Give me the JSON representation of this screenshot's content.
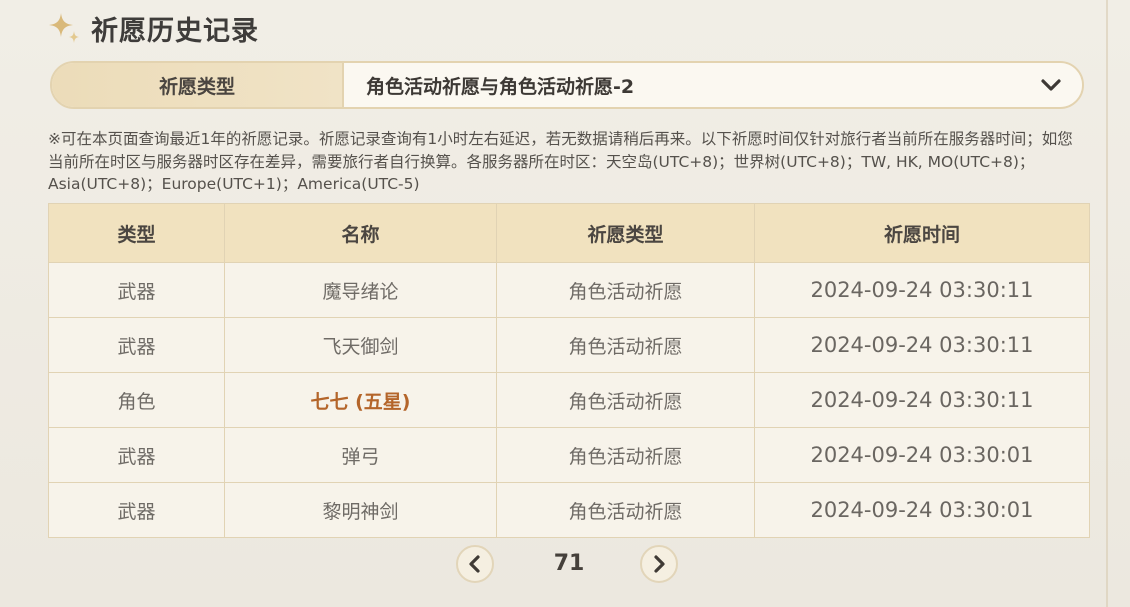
{
  "header": {
    "title": "祈愿历史记录",
    "icon": "sparkle-star-icon"
  },
  "wish_type": {
    "label": "祈愿类型",
    "selected": "角色活动祈愿与角色活动祈愿-2",
    "icon": "chevron-down-icon"
  },
  "notice": "※可在本页面查询最近1年的祈愿记录。祈愿记录查询有1小时左右延迟，若无数据请稍后再来。以下祈愿时间仅针对旅行者当前所在服务器时间；如您当前所在时区与服务器时区存在差异，需要旅行者自行换算。各服务器所在时区：天空岛(UTC+8)；世界树(UTC+8)；TW, HK, MO(UTC+8)；Asia(UTC+8)；Europe(UTC+1)；America(UTC-5)",
  "table": {
    "headers": [
      "类型",
      "名称",
      "祈愿类型",
      "祈愿时间"
    ],
    "rows": [
      {
        "type": "武器",
        "name": "魔导绪论",
        "wish": "角色活动祈愿",
        "time": "2024-09-24 03:30:11"
      },
      {
        "type": "武器",
        "name": "飞天御剑",
        "wish": "角色活动祈愿",
        "time": "2024-09-24 03:30:11"
      },
      {
        "type": "角色",
        "name": "七七 (五星)",
        "wish": "角色活动祈愿",
        "time": "2024-09-24 03:30:11"
      },
      {
        "type": "武器",
        "name": "弹弓",
        "wish": "角色活动祈愿",
        "time": "2024-09-24 03:30:01"
      },
      {
        "type": "武器",
        "name": "黎明神剑",
        "wish": "角色活动祈愿",
        "time": "2024-09-24 03:30:01"
      }
    ]
  },
  "pager": {
    "page": "71",
    "prev_icon": "chevron-left-icon",
    "next_icon": "chevron-right-icon"
  },
  "colors": {
    "five_star": "#b4652a",
    "header_bg": "#f1e2bf",
    "row_bg": "#f7f3ea"
  }
}
